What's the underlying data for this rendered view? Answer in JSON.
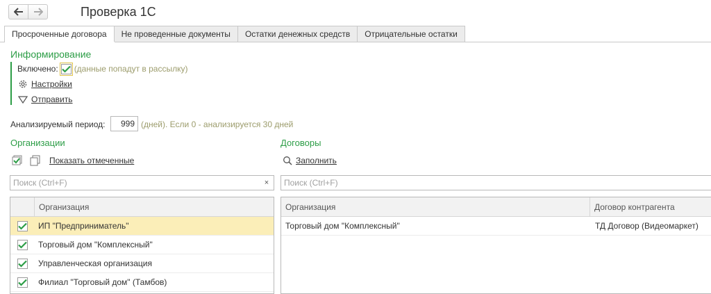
{
  "window": {
    "title": "Проверка 1С"
  },
  "tabs": [
    {
      "label": "Просроченные договора",
      "active": true
    },
    {
      "label": "Не проведенные документы",
      "active": false
    },
    {
      "label": "Остатки денежных средств",
      "active": false
    },
    {
      "label": "Отрицательные остатки",
      "active": false
    }
  ],
  "informing": {
    "title": "Информирование",
    "enabled_label": "Включено:",
    "enabled": true,
    "enabled_hint": "(данные попадут в рассылку)",
    "settings_label": "Настройки",
    "send_label": "Отправить"
  },
  "period": {
    "label": "Анализируемый период:",
    "value": "999",
    "hint": "(дней). Если 0 - анализируется 30 дней"
  },
  "organizations": {
    "title": "Организации",
    "show_checked_label": "Показать отмеченные",
    "search_placeholder": "Поиск (Ctrl+F)",
    "clear_label": "×",
    "column": "Организация",
    "rows": [
      {
        "name": "ИП \"Предприниматель\"",
        "checked": true,
        "selected": true
      },
      {
        "name": "Торговый дом \"Комплексный\"",
        "checked": true,
        "selected": false
      },
      {
        "name": "Управленческая организация",
        "checked": true,
        "selected": false
      },
      {
        "name": "Филиал \"Торговый дом\" (Тамбов)",
        "checked": true,
        "selected": false
      }
    ]
  },
  "contracts": {
    "title": "Договоры",
    "fill_label": "Заполнить",
    "search_placeholder": "Поиск (Ctrl+F)",
    "columns": [
      "Организация",
      "Договор контрагента"
    ],
    "rows": [
      {
        "organization": "Торговый дом \"Комплексный\"",
        "contract": "ТД Договор (Видеомаркет)"
      }
    ]
  },
  "colors": {
    "accent_green": "#2c9d46",
    "selection": "#fbeeb8",
    "hint": "#9c9c6c"
  }
}
